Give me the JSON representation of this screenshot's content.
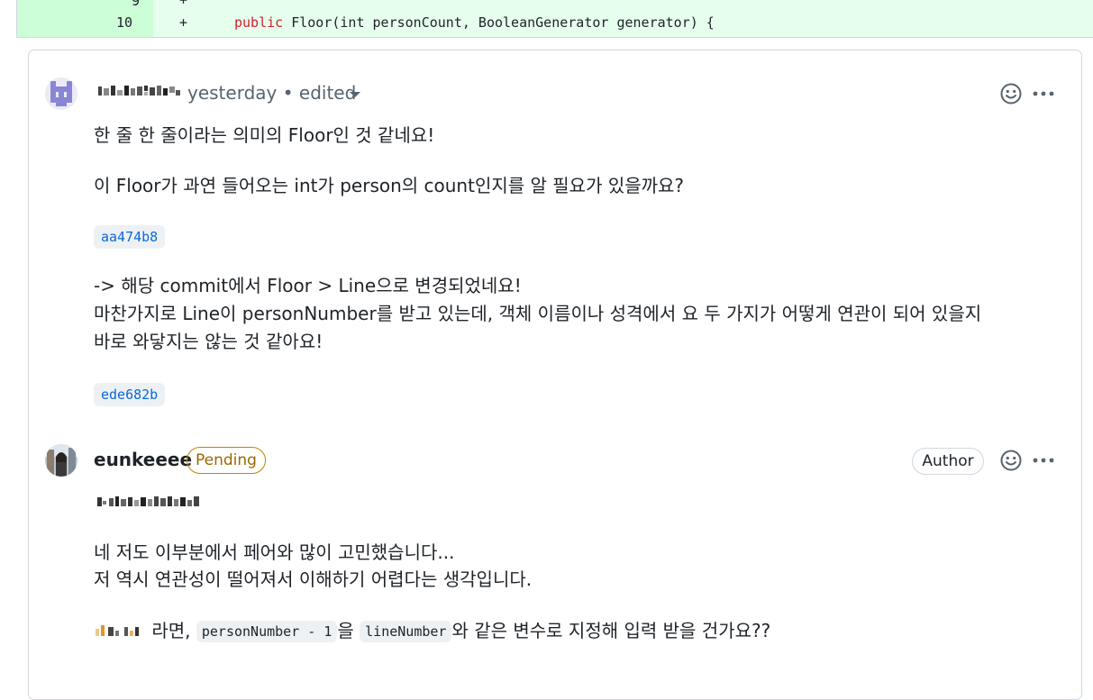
{
  "diff": {
    "line_number": "10",
    "marker": "+",
    "code_keyword": "public",
    "code_rest": " Floor(int personCount, BooleanGenerator generator) {"
  },
  "comments": [
    {
      "timestamp": "yesterday",
      "separator": "•",
      "edited_label": "edited",
      "paragraphs": [
        "한 줄 한 줄이라는 의미의 Floor인 것 같네요!",
        "이 Floor가 과연 들어오는 int가 person의 count인지를 알 필요가 있을까요?"
      ],
      "commit1": "aa474b8",
      "lines_after": [
        "-> 해당 commit에서 Floor > Line으로 변경되었네요!",
        "마찬가지로 Line이 personNumber를 받고 있는데, 객체 이름이나 성격에서 요 두 가지가 어떻게 연관이 되어 있을지",
        "바로 와닿지는 않는 것 같아요!"
      ],
      "commit2": "ede682b"
    },
    {
      "author": "eunkeeee",
      "pending_label": "Pending",
      "author_badge": "Author",
      "lines": [
        "네 저도 이부분에서 페어와 많이 고민했습니다...",
        "저 역시 연관성이 떨어져서 이해하기 어렵다는 생각입니다."
      ],
      "last_line_text1": " 라면, ",
      "code1": "personNumber - 1",
      "last_line_text2": "을 ",
      "code2": "lineNumber",
      "last_line_text3": "와 같은 변수로 지정해 입력 받을 건가요??"
    }
  ],
  "icons": {
    "emoji": "smiley-icon",
    "more": "kebab-icon",
    "caret": "caret-down-icon"
  }
}
